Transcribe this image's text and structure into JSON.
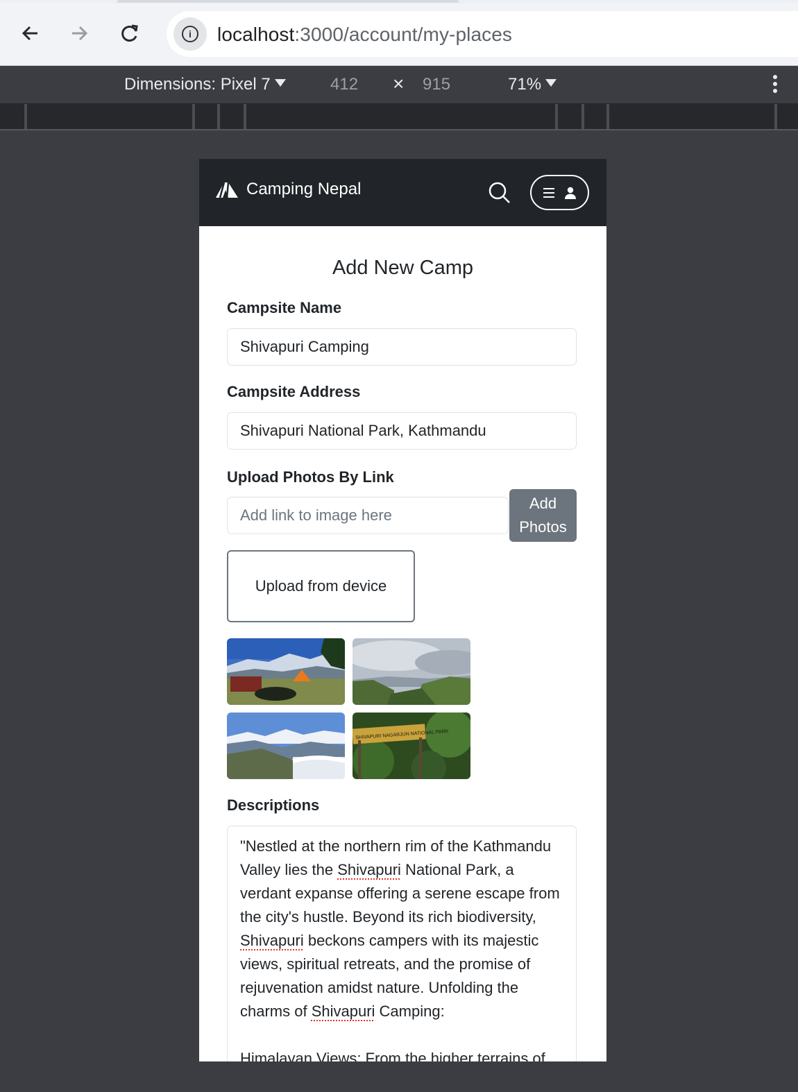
{
  "browser": {
    "url_host": "localhost",
    "url_path": ":3000/account/my-places",
    "back_icon": "arrow-left-icon",
    "forward_icon": "arrow-right-icon",
    "reload_icon": "reload-icon",
    "info_icon_glyph": "i"
  },
  "devtools": {
    "dimensions_label": "Dimensions: Pixel 7",
    "width": "412",
    "times": "×",
    "height": "915",
    "zoom": "71%"
  },
  "app": {
    "brand": "Camping Nepal",
    "colors": {
      "navbar": "#212529",
      "secondary_button": "#6c757d"
    }
  },
  "form": {
    "title": "Add New Camp",
    "name_label": "Campsite Name",
    "name_value": "Shivapuri Camping",
    "address_label": "Campsite Address",
    "address_value": "Shivapuri National Park, Kathmandu",
    "photos_label": "Upload Photos By Link",
    "link_placeholder": "Add link to image here",
    "add_photos_line1": "Add",
    "add_photos_line2": "Photos",
    "upload_device": "Upload from device",
    "photo_sign_text": "SHIVAPURI NAGARJUN NATIONAL PARK",
    "descriptions_label": "Descriptions",
    "description": {
      "p1_a": "\"Nestled at the northern rim of the Kathmandu Valley lies the ",
      "shiv1": "Shivapuri",
      "p1_b": " National Park, a verdant expanse offering a serene escape from the city's hustle. Beyond its rich biodiversity, ",
      "shiv2": "Shivapuri",
      "p1_c": " beckons campers with its majestic views, spiritual retreats, and the promise of rejuvenation amidst nature. Unfolding the charms of ",
      "shiv3": "Shivapuri",
      "p1_d": " Camping:",
      "p2": "Himalayan Views: From the higher terrains of"
    }
  }
}
